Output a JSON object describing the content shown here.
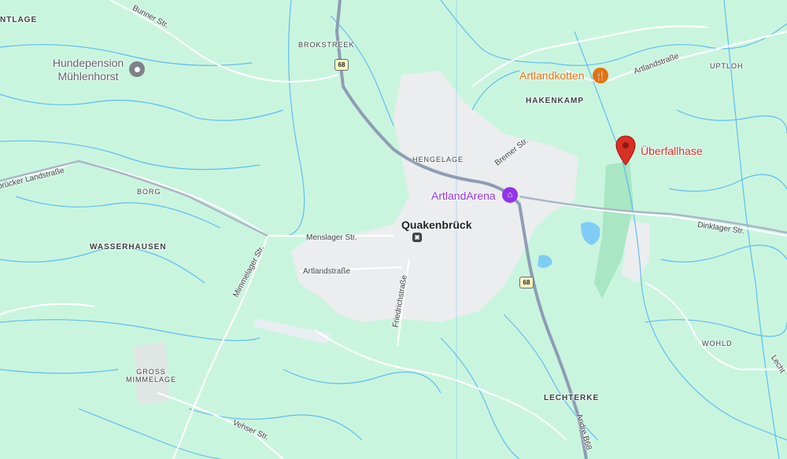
{
  "map": {
    "places": {
      "ntlage": "NTLAGE",
      "brokstreek": "BROKSTREEK",
      "hakenkamp": "HAKENKAMP",
      "uptloh": "UPTLOH",
      "hengelage": "HENGELAGE",
      "borg": "BORG",
      "wasserhausen": "WASSERHAUSEN",
      "gross_mimmelage": "GROSS\nMIMMELAGE",
      "lechterke": "LECHTERKE",
      "wohld": "WOHLD",
      "quakenbrueck": "Quakenbrück"
    },
    "streets": {
      "bunner": "Bunner Str.",
      "landstr_left": "brücker Landstraße",
      "artland_str_ne": "Artlandstraße",
      "bremer": "Bremer Str.",
      "menslager": "Menslager Str.",
      "artlandstrasse": "Artlandstraße",
      "friedrichstrasse": "Friedrichstraße",
      "mimmelager": "Mimmelager Str.",
      "dinklager": "Dinklager Str.",
      "vehser": "Vehser Str.",
      "andre": "Andre B68",
      "lecht": "Lecht"
    },
    "road_shields": {
      "b68_top": "68",
      "b68_bottom": "68"
    },
    "pois": {
      "hundepension": {
        "label": "Hundepension\nMühlenhorst",
        "icon": "location-pin-icon",
        "color": "#7d8288"
      },
      "artlandkotten": {
        "label": "Artlandkotten",
        "icon": "restaurant-icon",
        "color": "#e8710a"
      },
      "artlandarena": {
        "label": "ArtlandArena",
        "icon": "landmark-icon",
        "color": "#9334e6"
      },
      "ueberfallhase": {
        "label": "Überfallhase",
        "icon": "red-marker-icon",
        "color": "#d93025"
      }
    },
    "colors": {
      "land": "#c9f5df",
      "water": "#4fb3f0",
      "road_major": "#8e9db3",
      "road_minor": "#ffffff",
      "urban": "#ebedef",
      "park": "#a8e6c4"
    }
  }
}
